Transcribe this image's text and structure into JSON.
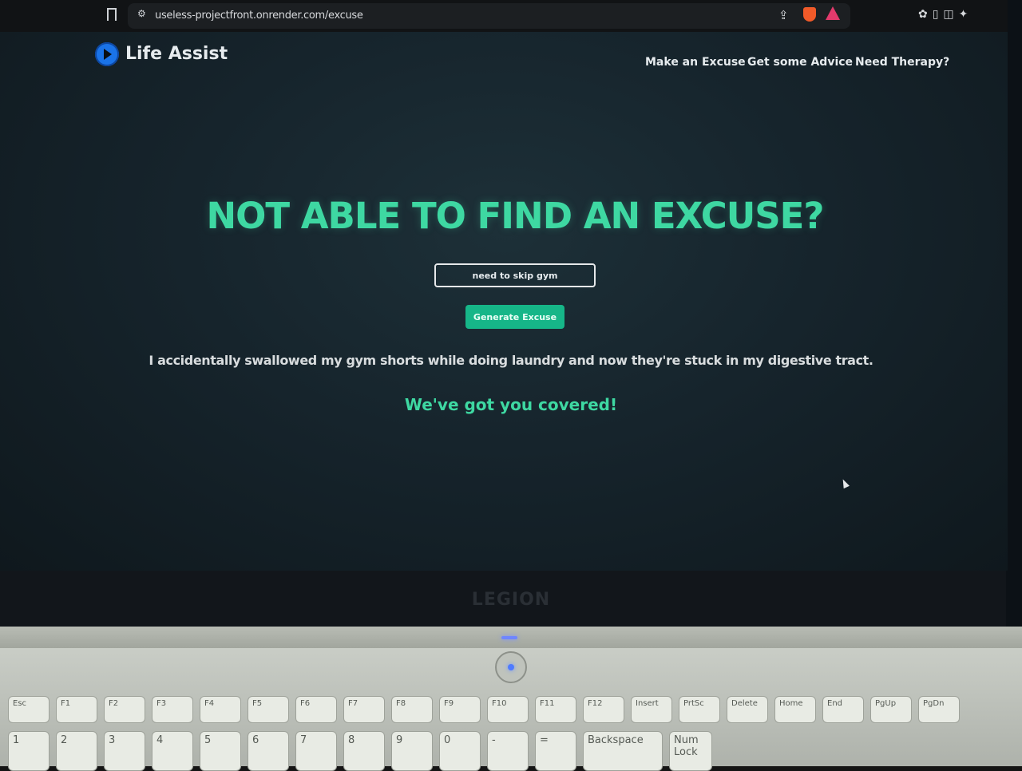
{
  "browser": {
    "url": "useless-projectfront.onrender.com/excuse"
  },
  "site": {
    "name": "Life Assist",
    "nav": [
      "Make an Excuse",
      "Get some Advice",
      "Need Therapy?"
    ]
  },
  "hero": {
    "title": "NOT ABLE TO FIND AN EXCUSE?",
    "input_value": "need to skip gym",
    "button_label": "Generate Excuse",
    "result_text": "I accidentally swallowed my gym shorts while doing laundry and now they're stuck in my digestive tract.",
    "tagline": "We've got you covered!"
  },
  "laptop": {
    "brand": "LEGION",
    "function_keys": [
      "Esc",
      "F1",
      "F2",
      "F3",
      "F4",
      "F5",
      "F6",
      "F7",
      "F8",
      "F9",
      "F10",
      "F11",
      "F12",
      "Insert",
      "PrtSc",
      "Delete",
      "Home",
      "End",
      "PgUp",
      "PgDn"
    ],
    "number_keys": [
      "1",
      "2",
      "3",
      "4",
      "5",
      "6",
      "7",
      "8",
      "9",
      "0",
      "-",
      "=",
      "Backspace",
      "Num Lock"
    ]
  }
}
